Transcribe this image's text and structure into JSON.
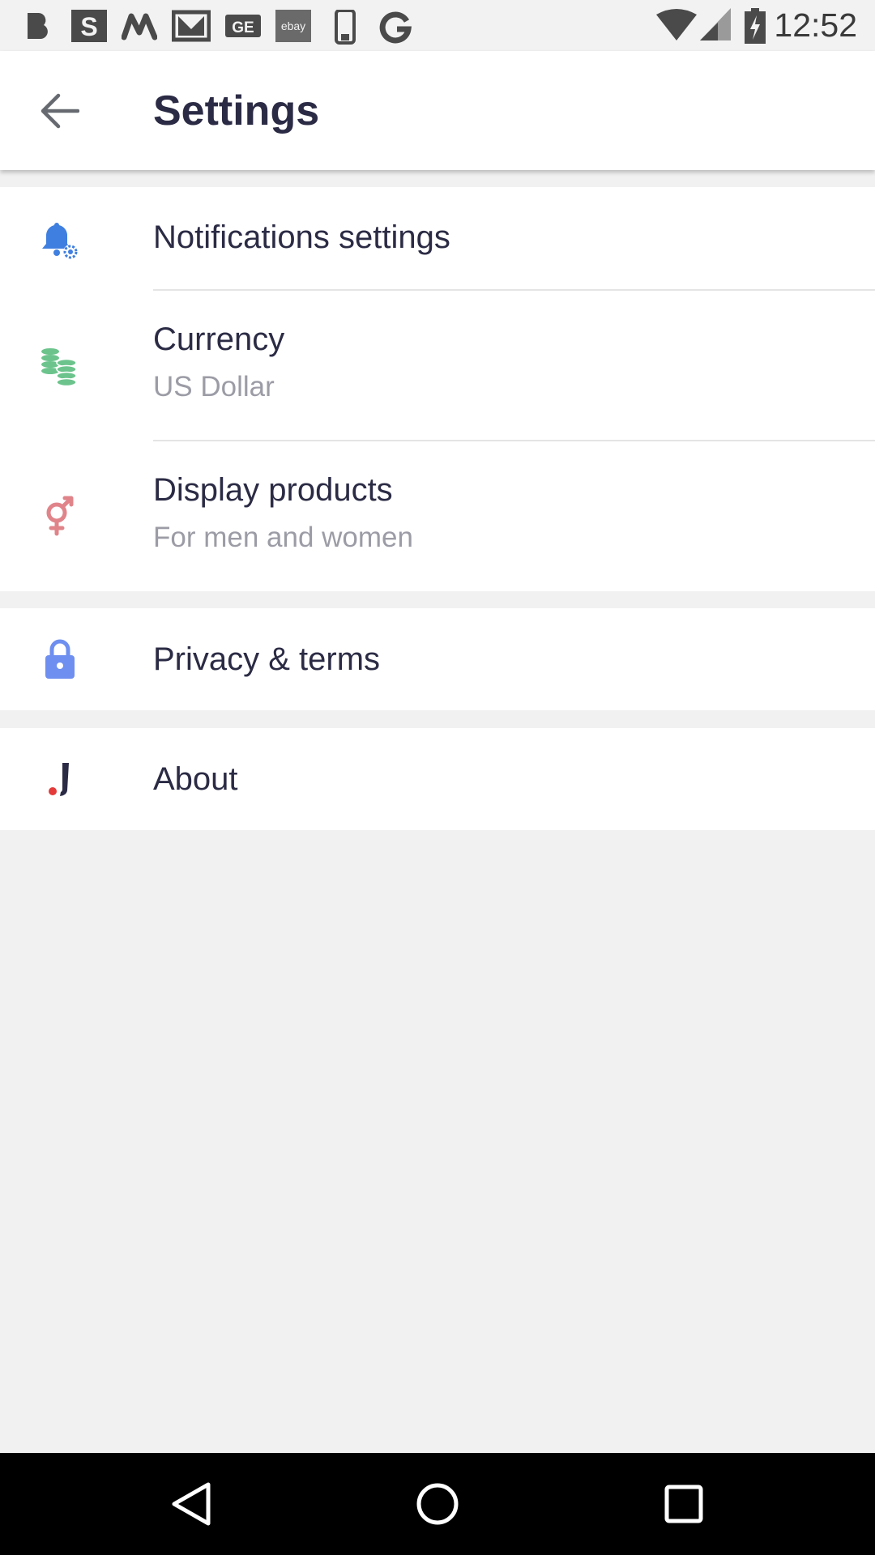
{
  "status_bar": {
    "time": "12:52",
    "notification_icons": [
      "beats-icon",
      "s-app-icon",
      "myntra-icon",
      "gmail-icon",
      "ge-icon",
      "ebay-icon",
      "phone-icon",
      "google-icon"
    ],
    "ebay_label": "ebay"
  },
  "app_bar": {
    "title": "Settings",
    "back_icon": "arrow-back-icon"
  },
  "settings": {
    "notifications": {
      "title": "Notifications settings",
      "icon": "bell-gear-icon",
      "icon_color": "#3f7fe0"
    },
    "currency": {
      "title": "Currency",
      "value": "US Dollar",
      "icon": "coins-icon",
      "icon_color": "#6cc48c"
    },
    "display_products": {
      "title": "Display products",
      "value": "For men and women",
      "icon": "gender-icon",
      "icon_color": "#e0848a"
    },
    "privacy": {
      "title": "Privacy & terms",
      "icon": "lock-icon",
      "icon_color": "#6e8ff0"
    },
    "about": {
      "title": "About",
      "icon": "app-logo-icon",
      "icon_color": "#2b2b45",
      "dot_color": "#e43a3a"
    }
  },
  "nav_bar": {
    "back": "nav-back-icon",
    "home": "nav-home-icon",
    "recents": "nav-recents-icon"
  }
}
